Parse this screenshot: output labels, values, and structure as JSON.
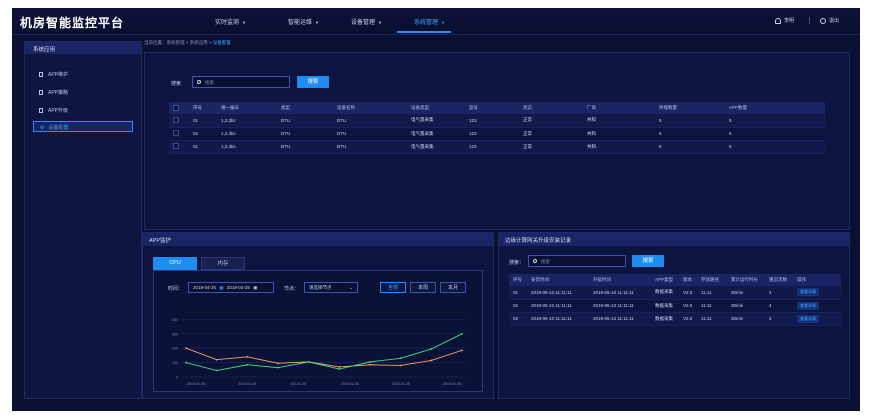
{
  "app": {
    "title": "机房智能监控平台"
  },
  "nav": {
    "items": [
      {
        "label": "实时监测",
        "active": false
      },
      {
        "label": "智能运维",
        "active": false
      },
      {
        "label": "设备管理",
        "active": false
      },
      {
        "label": "系统管理",
        "active": true
      }
    ]
  },
  "user": {
    "name": "李明",
    "logout": "退出"
  },
  "sidebar": {
    "title": "系统应用",
    "items": [
      {
        "label": "APP维护",
        "icon": "doc-icon",
        "active": false
      },
      {
        "label": "APP策略",
        "icon": "doc-icon",
        "active": false
      },
      {
        "label": "APP升级",
        "icon": "doc-icon",
        "active": false
      },
      {
        "label": "设备配置",
        "icon": "gear-icon",
        "active": true
      }
    ]
  },
  "breadcrumb": {
    "prefix": "当前位置：系统管理 > 系统应用 > ",
    "current": "设备配置"
  },
  "top_panel": {
    "search_label": "搜索",
    "search_placeholder": "搜索",
    "search_button": "搜索",
    "columns": [
      "序号",
      "唯一编号",
      "类型",
      "设备名称",
      "设备类型",
      "型号",
      "状态",
      "厂商",
      "终端数量",
      "APP数量"
    ],
    "rows": [
      [
        "01",
        "1,2,3bc",
        "DTU",
        "DTU",
        "电气量采集",
        "123",
        "正常",
        "共和",
        "5",
        "5"
      ],
      [
        "02",
        "1,2,3bc",
        "DTU",
        "DTU",
        "电气量采集",
        "123",
        "正常",
        "共和",
        "5",
        "5"
      ],
      [
        "01",
        "1,2,3bc",
        "DTU",
        "DTU",
        "电气量采集",
        "123",
        "正常",
        "共和",
        "5",
        "5"
      ]
    ]
  },
  "app_panel": {
    "title": "APP监护",
    "tabs": [
      {
        "label": "CPU",
        "active": true
      },
      {
        "label": "内存",
        "active": false
      }
    ],
    "time_label": "时间：",
    "date_from": "2019-04-25",
    "date_to": "2019-04-25",
    "node_label": "节点：",
    "node_value": "请选择节点",
    "range_buttons": [
      {
        "label": "全部",
        "active": true
      },
      {
        "label": "本周",
        "active": false
      },
      {
        "label": "本月",
        "active": false
      }
    ]
  },
  "chart_data": {
    "type": "line",
    "x": [
      "2019-01-08",
      "2019-01-08",
      "GO-01-08",
      "2019-01-08",
      "2019-01-08",
      "2019-01-08"
    ],
    "y_ticks": [
      "400",
      "300",
      "200",
      "100",
      "0"
    ],
    "ylim": [
      0,
      500
    ],
    "series": [
      {
        "color": "#f7a35c",
        "values": [
          200,
          120,
          140,
          95,
          105,
          70,
          85,
          80,
          115,
          185
        ]
      },
      {
        "color": "#3fe07a",
        "values": [
          100,
          45,
          85,
          65,
          105,
          55,
          105,
          130,
          195,
          300
        ]
      }
    ]
  },
  "upgrade_panel": {
    "title": "边缘计算网关升级安装记录",
    "search_label": "搜索：",
    "search_placeholder": "搜索",
    "search_button": "搜索",
    "columns": [
      "序号",
      "安装时间",
      "升级时间",
      "APP类型",
      "版本",
      "存放路径",
      "累计运行时长",
      "重启次数",
      "操作"
    ],
    "rows": [
      [
        "01",
        "2019-05-13 11:11:11",
        "2019-05-13 11:11:11",
        "数据采集",
        "V2.0",
        "11:11",
        "30min",
        "4",
        "查看详情"
      ],
      [
        "02",
        "2019-05-13 11:11:11",
        "2019-05-13 11:11:11",
        "数据采集",
        "V2.0",
        "11:11",
        "30min",
        "4",
        "查看详情"
      ],
      [
        "03",
        "2019-05-13 11:11:11",
        "2019-05-13 11:11:11",
        "数据采集",
        "V2.0",
        "11:11",
        "30min",
        "4",
        "查看详情"
      ]
    ]
  },
  "colors": {
    "accent": "#1e8cf0",
    "bg": "#0b1033",
    "ok": "#3fe07a"
  }
}
